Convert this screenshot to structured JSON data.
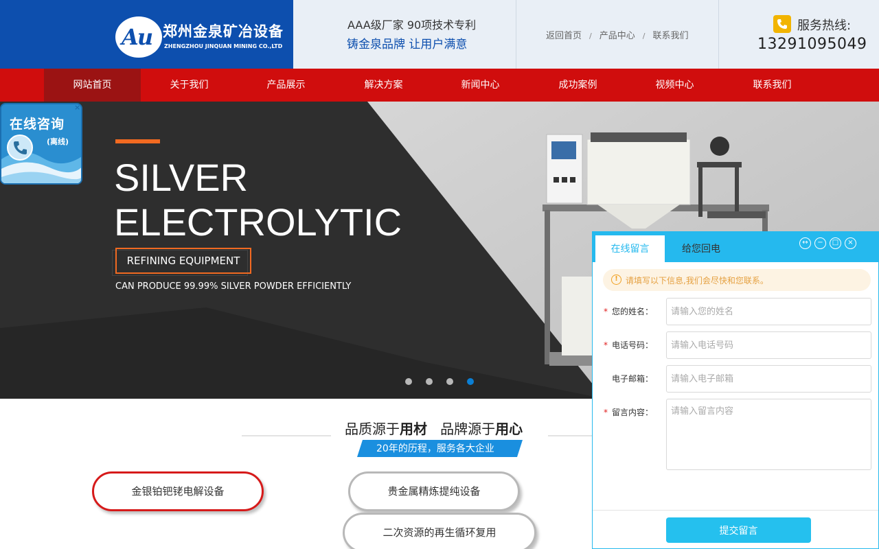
{
  "header": {
    "logo_mark": "Au",
    "logo_cn": "郑州金泉矿冶设备",
    "logo_en": "ZHENGZHOU JINQUAN MINING  CO.,LTD",
    "slogan_line1": "AAA级厂家 90项技术专利",
    "slogan_line2": "铸金泉品牌 让用户满意",
    "top_links": [
      "返回首页",
      "产品中心",
      "联系我们"
    ],
    "link_separator": "/",
    "hotline_label": "服务热线:",
    "hotline_number": "13291095049",
    "colors": {
      "logo_bg": "#0d4fae",
      "header_bg": "#e9eff6",
      "hotline_icon": "#f2b400"
    }
  },
  "nav": {
    "items": [
      "网站首页",
      "关于我们",
      "产品展示",
      "解决方案",
      "新闻中心",
      "成功案例",
      "视频中心",
      "联系我们"
    ],
    "active_index": 0,
    "colors": {
      "bg": "#d00d0d",
      "active_bg": "#9b1313"
    }
  },
  "banner": {
    "title_line1": "SILVER",
    "title_line2": "ELECTROLYTIC",
    "button_label": "REFINING EQUIPMENT",
    "subtitle": "CAN PRODUCE 99.99% SILVER POWDER EFFICIENTLY",
    "slide_count": 4,
    "active_slide": 4,
    "colors": {
      "accent": "#f26a21",
      "active_dot": "#0b7fd4"
    }
  },
  "float_widget": {
    "title": "在线咨询",
    "status": "(离线)",
    "close_symbol": "×"
  },
  "quality": {
    "title_part1": "品质源于",
    "title_bold1": "用材",
    "title_part2": "品牌源于",
    "title_bold2": "用心",
    "banner_text": "20年的历程，服务各大企业",
    "categories": [
      "金银铂钯铑电解设备",
      "贵金属精炼提纯设备",
      "二次资源的再生循环复用"
    ]
  },
  "message_panel": {
    "tab_active": "在线留言",
    "tab_other": "给您回电",
    "controls": [
      "↔",
      "−",
      "□",
      "×"
    ],
    "notice": "请填写以下信息,我们会尽快和您联系。",
    "fields": {
      "name": {
        "label": "您的姓名：",
        "required": true,
        "placeholder": "请输入您的姓名"
      },
      "phone": {
        "label": "电话号码：",
        "required": true,
        "placeholder": "请输入电话号码"
      },
      "email": {
        "label": "电子邮箱：",
        "required": false,
        "placeholder": "请输入电子邮箱"
      },
      "message": {
        "label": "留言内容：",
        "required": true,
        "placeholder": "请输入留言内容"
      }
    },
    "required_mark": "*",
    "submit_label": "提交留言",
    "colors": {
      "accent": "#25b9ee",
      "notice_bg": "#fdf3e3",
      "notice_text": "#e5a040"
    }
  }
}
